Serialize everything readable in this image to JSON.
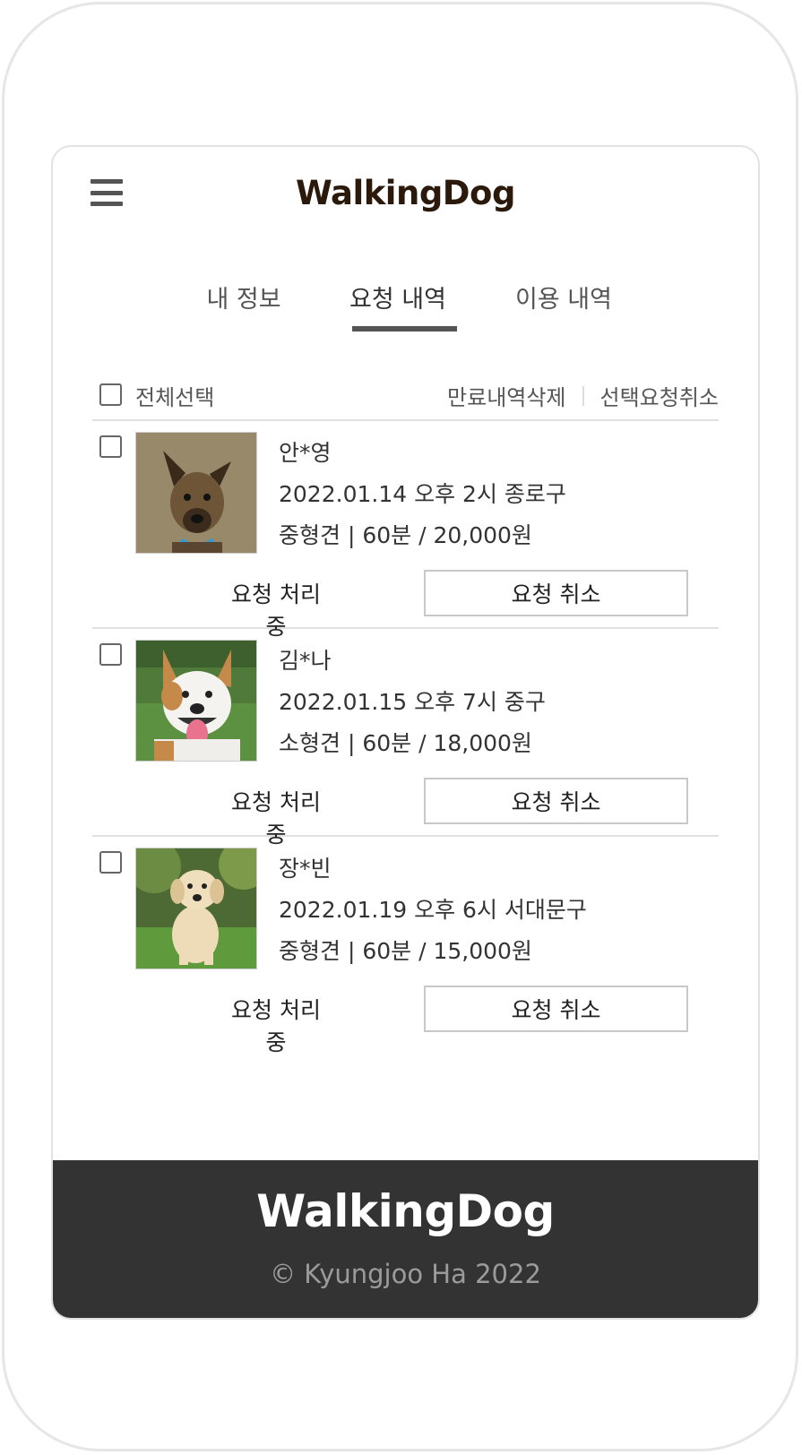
{
  "header": {
    "menu_icon": "hamburger-menu-icon",
    "logo": "WalkingDog"
  },
  "tabs": [
    {
      "label": "내 정보",
      "active": false
    },
    {
      "label": "요청 내역",
      "active": true
    },
    {
      "label": "이용 내역",
      "active": false
    }
  ],
  "toolbar": {
    "select_all_label": "전체선택",
    "delete_expired_label": "만료내역삭제",
    "cancel_selected_label": "선택요청취소"
  },
  "requests": [
    {
      "name": "안*영",
      "datetime": "2022.01.14 오후 2시 종로구",
      "detail": "중형견 | 60분 / 20,000원",
      "status": "요청 처리 중",
      "cancel_label": "요청 취소",
      "photo": "dog-photo-mixed-breed"
    },
    {
      "name": "김*나",
      "datetime": "2022.01.15 오후 7시 중구",
      "detail": "소형견 | 60분 / 18,000원",
      "status": "요청 처리 중",
      "cancel_label": "요청 취소",
      "photo": "dog-photo-smiling-terrier"
    },
    {
      "name": "장*빈",
      "datetime": "2022.01.19 오후 6시 서대문구",
      "detail": "중형견 | 60분 / 15,000원",
      "status": "요청 처리 중",
      "cancel_label": "요청 취소",
      "photo": "dog-photo-golden-puppy"
    }
  ],
  "footer": {
    "logo": "WalkingDog",
    "copyright": "© Kyungjoo Ha 2022"
  },
  "colors": {
    "logo": "#2b1a0c",
    "footer_bg": "#333333",
    "footer_text": "#9b9b9b",
    "tab_underline": "#555555"
  }
}
